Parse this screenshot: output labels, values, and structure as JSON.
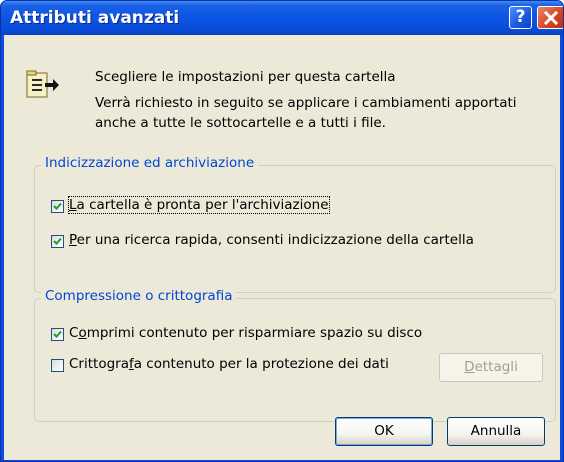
{
  "window": {
    "title": "Attributi avanzati",
    "help_button": "?",
    "close_button": "×"
  },
  "intro": {
    "line1": "Scegliere le impostazioni per questa cartella",
    "line2": "Verrà richiesto in seguito se applicare i cambiamenti apportati",
    "line3": "anche a tutte le sottocartelle e a tutti i file."
  },
  "archive_group": {
    "legend": "Indicizzazione ed archiviazione",
    "ready_for_archive": {
      "label_pre": "",
      "accel": "L",
      "label_post": "a cartella è pronta per l'archiviazione",
      "checked": true
    },
    "fast_indexing": {
      "label_pre": "",
      "accel": "P",
      "label_post": "er una ricerca rapida, consenti indicizzazione della cartella",
      "checked": true
    }
  },
  "compress_group": {
    "legend": "Compressione o crittografia",
    "compress": {
      "label_pre": "C",
      "accel": "o",
      "label_post": "mprimi contenuto per risparmiare spazio su disco",
      "checked": true
    },
    "encrypt": {
      "label_pre": "Crittogra",
      "accel": "f",
      "label_post": "a contenuto per la protezione dei dati",
      "checked": false
    },
    "details_button": {
      "accel": "D",
      "rest": "ettagli",
      "enabled": false
    }
  },
  "buttons": {
    "ok": "OK",
    "cancel": "Annulla"
  },
  "colors": {
    "titlebar": "#0a4ce0",
    "dialog_bg": "#ece9d8",
    "legend_text": "#0046d5",
    "checkmark": "#21a121",
    "close_button": "#d6431e"
  }
}
